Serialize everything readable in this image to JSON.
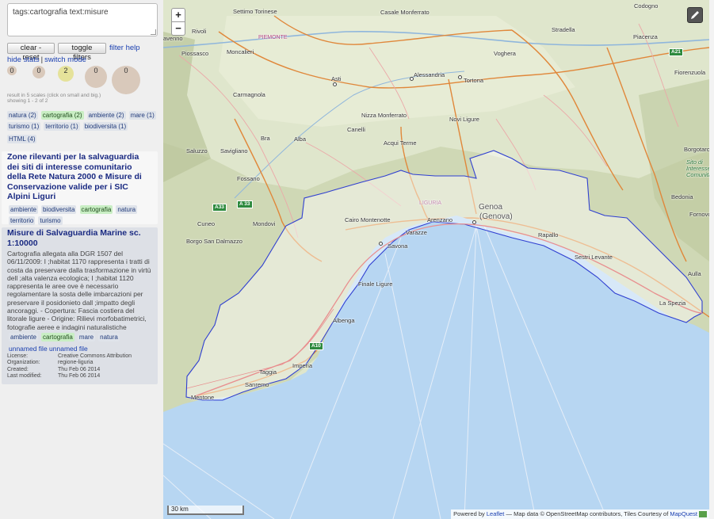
{
  "sidebar": {
    "query": "tags:cartografia text:misure",
    "clear_label": "clear - reset",
    "toggle_label": "toggle filters",
    "filter_help_label": "filter help",
    "hide_stats_label": "hide stats",
    "switch_mode_label": "switch mode",
    "scales": [
      "0",
      "0",
      "2",
      "0",
      "0"
    ],
    "result_scales_line": "result in 5 scales (click on small and big.)",
    "showing_line": "showing 1 - 2 of 2",
    "facets": [
      {
        "label": "natura (2)"
      },
      {
        "label": "cartografia (2)"
      },
      {
        "label": "ambiente (2)"
      },
      {
        "label": "mare (1)"
      },
      {
        "label": "turismo (1)"
      },
      {
        "label": "territorio (1)"
      },
      {
        "label": "biodiversita (1)"
      }
    ],
    "facet_html": "HTML (4)"
  },
  "results": [
    {
      "title": "Zone rilevanti per la salvaguardia dei siti di interesse comunitario della Rete Natura 2000 e Misure di Conservazione valide per i SIC Alpini Liguri",
      "tags": [
        "ambiente",
        "biodiversita",
        "cartografia",
        "natura",
        "territorio",
        "turismo"
      ]
    },
    {
      "title": "Misure di Salvaguardia Marine sc. 1:10000",
      "description": "Cartografia allegata alla DGR 1507 del 06/11/2009: I ;habitat 1170 rappresenta i tratti di costa da preservare dalla trasformazione in virtù dell ;alta valenza ecologica; I ;habitat 1120 rappresenta le aree ove è necessario regolamentare la sosta delle imbarcazioni per preservare il posidonieto dall ;impatto degli ancoraggi. - Copertura: Fascia costiera del litorale ligure - Origine: Rilievi morfobatimetrici, fotografie aeree e indagini naturalistiche",
      "tags": [
        "ambiente",
        "cartografia",
        "mare",
        "natura"
      ],
      "file1": "unnamed file",
      "file2": "unnamed file",
      "meta": {
        "license_k": "License:",
        "license_v": "Creative Commons Attribution",
        "org_k": "Organization:",
        "org_v": "regione-liguria",
        "created_k": "Created:",
        "created_v": "Thu Feb 06 2014",
        "modified_k": "Last modified:",
        "modified_v": "Thu Feb 06 2014"
      }
    }
  ],
  "map": {
    "zoom_in": "+",
    "zoom_out": "−",
    "scale_label": "30 km",
    "attribution": {
      "prefix": "Powered by",
      "leaflet": "Leaflet",
      "middle": "— Map data © OpenStreetMap contributors, Tiles Courtesy of",
      "mapquest": "MapQuest"
    },
    "labels": {
      "settimo": "Settimo Torinese",
      "casale": "Casale Monferrato",
      "codogno": "Codogno",
      "rivoli": "Rivoli",
      "avenno": "avenno",
      "piemonte": "PIEMONTE",
      "stradella": "Stradella",
      "piacenza": "Piacenza",
      "piossasco": "Piossasco",
      "moncalieri": "Moncalieri",
      "voghera": "Voghera",
      "fiorenzuola": "Fiorenzuola",
      "asti": "Asti",
      "alessandria": "Alessandria",
      "tortona": "Tortona",
      "carmagnola": "Carmagnola",
      "nizza": "Nizza Monferrato",
      "novi": "Novi Ligure",
      "canelli": "Canelli",
      "bra": "Bra",
      "alba": "Alba",
      "acqui": "Acqui Terme",
      "saluzzo": "Saluzzo",
      "savigliano": "Savigliano",
      "fossano": "Fossano",
      "liguria": "LIGURIA",
      "cairo": "Cairo Montenotte",
      "arenzano": "Arenzano",
      "genoa": "Genoa",
      "genova": "(Genova)",
      "varazze": "Varazze",
      "rapallo": "Rapallo",
      "cuneo": "Cuneo",
      "mondovi": "Mondovi",
      "savona": "Savona",
      "borgo": "Borgo San Dalmazzo",
      "sestri": "Sestri Levante",
      "finale": "Finale Ligure",
      "aulla": "Aulla",
      "laspezia": "La Spezia",
      "albenga": "Albenga",
      "imperia": "Imperia",
      "taggia": "Taggia",
      "sanremo": "Sanremo",
      "mentone": "Mentone",
      "borgotaro": "Borgotaro",
      "bedonia": "Bedonia",
      "sito1": "Sito di",
      "sito2": "Interesse",
      "sito3": "Comunitario",
      "fornovo": "Fornovo"
    },
    "shields": {
      "a21": "A21",
      "a33a": "A33",
      "a33b": "A 33",
      "a10": "A10"
    }
  }
}
